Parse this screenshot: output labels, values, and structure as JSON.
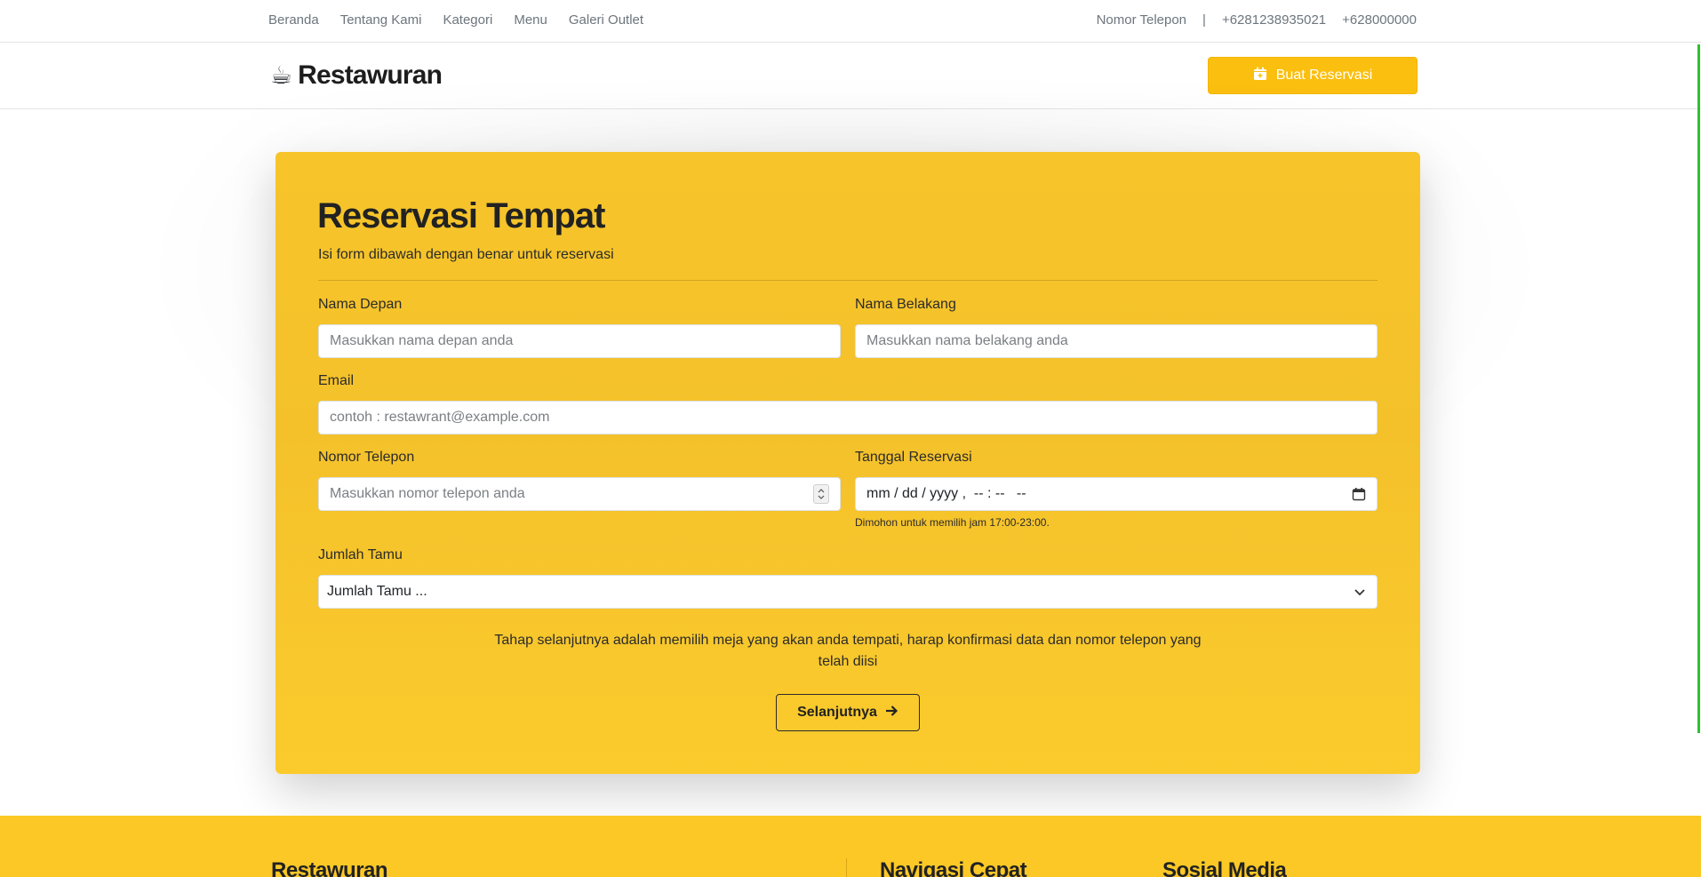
{
  "topnav": {
    "items": [
      "Beranda",
      "Tentang Kami",
      "Kategori",
      "Menu",
      "Galeri Outlet"
    ],
    "contact_label": "Nomor Telepon",
    "separator": "|",
    "phone1": "+6281238935021",
    "phone2": "+628000000"
  },
  "header": {
    "brand_icon": "☕",
    "brand_name": "Restawuran",
    "reserve_button": "Buat Reservasi"
  },
  "form": {
    "title": "Reservasi Tempat",
    "subtitle": "Isi form dibawah dengan benar untuk reservasi",
    "first_name_label": "Nama Depan",
    "first_name_placeholder": "Masukkan nama depan anda",
    "last_name_label": "Nama Belakang",
    "last_name_placeholder": "Masukkan nama belakang anda",
    "email_label": "Email",
    "email_placeholder": "contoh : restawrant@example.com",
    "phone_label": "Nomor Telepon",
    "phone_placeholder": "Masukkan nomor telepon anda",
    "date_label": "Tanggal Reservasi",
    "date_value": "mm / dd / yyyy ,  -- : --   --",
    "date_help": "Dimohon untuk memilih jam 17:00-23:00.",
    "guests_label": "Jumlah Tamu",
    "guests_selected": "Jumlah Tamu ...",
    "note": "Tahap selanjutnya adalah memilih meja yang akan anda tempati, harap konfirmasi data dan nomor telepon yang telah diisi",
    "next_button": "Selanjutnya",
    "next_icon": "arrow-right-icon"
  },
  "footer": {
    "col1_title": "Restawuran",
    "col2_title": "Navigasi Cepat",
    "col3_title": "Sosial Media"
  },
  "colors": {
    "accent": "#fbbf0f",
    "card_bg": "#f7c52a",
    "footer_bg": "#fbc826",
    "scroll_indicator": "#2fc12f"
  }
}
